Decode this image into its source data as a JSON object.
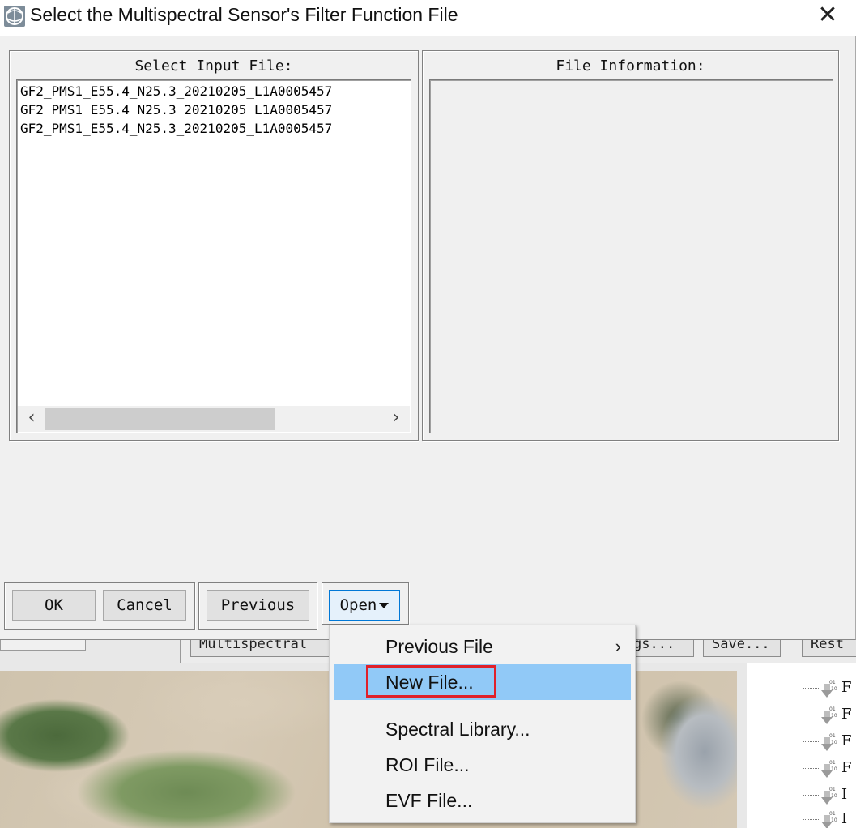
{
  "window": {
    "title": "Select the Multispectral Sensor's Filter Function File",
    "close_symbol": "✕"
  },
  "input_panel": {
    "label": "Select Input File:",
    "files": [
      "GF2_PMS1_E55.4_N25.3_20210205_L1A0005457",
      "GF2_PMS1_E55.4_N25.3_20210205_L1A0005457",
      "GF2_PMS1_E55.4_N25.3_20210205_L1A0005457"
    ],
    "scroll_left": "‹",
    "scroll_right": "›"
  },
  "info_panel": {
    "label": "File Information:"
  },
  "buttons": {
    "ok": "OK",
    "cancel": "Cancel",
    "previous": "Previous",
    "open": "Open"
  },
  "open_menu": {
    "items": [
      {
        "label": "Previous File",
        "submenu": "›"
      },
      {
        "label": "New File...",
        "highlighted": true
      },
      {
        "label": "Spectral Library..."
      },
      {
        "label": "ROI File..."
      },
      {
        "label": "EVF File..."
      }
    ]
  },
  "background_window": {
    "buttons": [
      "Multispectral",
      "gs...",
      "Save...",
      "Rest"
    ],
    "tree_labels": [
      "F",
      "F",
      "F",
      "F",
      "I",
      "I"
    ]
  },
  "colors": {
    "menu_highlight": "#91c9f7",
    "annotation_box": "#e0202a",
    "focus_border": "#0078d7"
  }
}
